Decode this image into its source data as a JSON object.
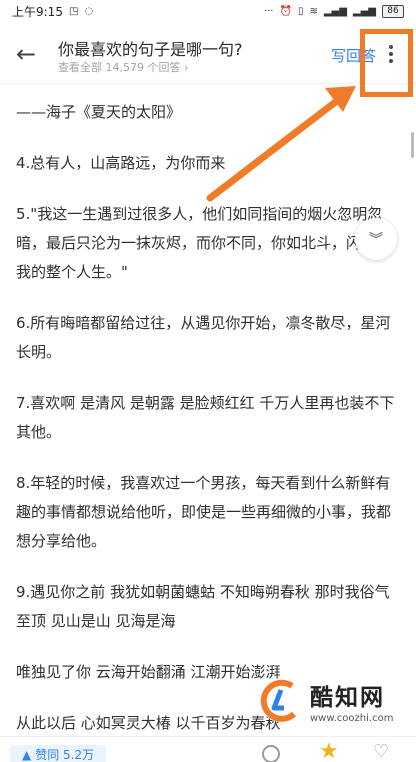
{
  "status_bar": {
    "time": "上午9:15",
    "battery": "86"
  },
  "header": {
    "back_icon": "arrow-left-icon",
    "title": "你最喜欢的句子是哪一句?",
    "meta": "查看全部 14,579 个回答 ›",
    "write_answer": "写回答",
    "more_icon": "more-vertical-icon"
  },
  "content": {
    "paragraphs": [
      "——海子《夏天的太阳》",
      "4.总有人，山高路远，为你而来",
      "5.\"我这一生遇到过很多人，他们如同指间的烟火忽明忽暗，最后只沦为一抹灰烬，而你不同，你如北斗，闪耀在我的整个人生。\"",
      "6.所有晦暗都留给过往，从遇见你开始，凛冬散尽，星河长明。",
      "7.喜欢啊 是清风 是朝露 是脸颊红红 千万人里再也装不下其他。",
      "8.年轻的时候，我喜欢过一个男孩，每天看到什么新鲜有趣的事情都想说给他听，即使是一些再细微的小事，我都想分享给他。",
      "9.遇见你之前 我犹如朝菌蟪蛄 不知晦朔春秋 那时我俗气至顶 见山是山 见海是海",
      "唯独见了你 云海开始翻涌 江潮开始澎湃",
      "从此以后 心如冥灵大椿 以千百岁为春秋"
    ]
  },
  "float_button": {
    "icon": "chevron-double-down-icon"
  },
  "bottom_bar": {
    "upvote_label": "赞同 5.2万",
    "comment_icon": "comment-icon",
    "star_icon": "star-icon",
    "heart_icon": "heart-icon"
  },
  "watermark": {
    "name": "酷知网",
    "url": "www.coozhi.com"
  },
  "colors": {
    "accent": "#2e83e6",
    "highlight": "#f07b28",
    "star": "#f4b21c"
  }
}
